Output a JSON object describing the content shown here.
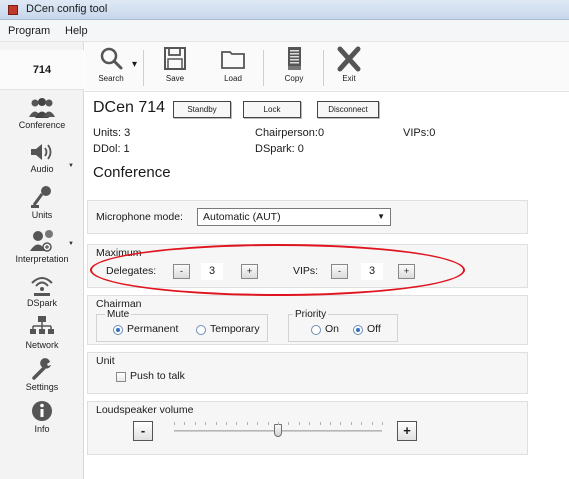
{
  "window": {
    "title": "DCen config tool"
  },
  "menu": [
    "Program",
    "Help"
  ],
  "sidebar": {
    "system_name": "714",
    "items": [
      {
        "label": "Conference",
        "icon": "people-icon"
      },
      {
        "label": "Audio",
        "icon": "speaker-icon"
      },
      {
        "label": "Units",
        "icon": "microphone-icon"
      },
      {
        "label": "Interpretation",
        "icon": "interpretation-icon"
      },
      {
        "label": "DSpark",
        "icon": "wireless-icon"
      },
      {
        "label": "Network",
        "icon": "network-icon"
      },
      {
        "label": "Settings",
        "icon": "wrench-icon"
      },
      {
        "label": "Info",
        "icon": "info-icon"
      }
    ]
  },
  "toolbar": {
    "search": "Search",
    "save": "Save",
    "load": "Load",
    "copy": "Copy",
    "exit": "Exit"
  },
  "header": {
    "device_name": "DCen 714",
    "standby_label": "Standby",
    "lock_label": "Lock",
    "disconnect_label": "Disconnect"
  },
  "stats": {
    "units": "Units: 3",
    "ddol": "DDol: 1",
    "chairperson": "Chairperson:0",
    "dspark": "DSpark: 0",
    "vips": "VIPs:0"
  },
  "section_title": "Conference",
  "microphone_mode": {
    "label": "Microphone mode:",
    "value": "Automatic (AUT)"
  },
  "maximum": {
    "title": "Maximum",
    "delegates_label": "Delegates:",
    "delegates_value": "3",
    "vips_label": "VIPs:",
    "vips_value": "3",
    "minus": "-",
    "plus": "+"
  },
  "chairman": {
    "title": "Chairman",
    "mute_title": "Mute",
    "permanent": "Permanent",
    "temporary": "Temporary",
    "mute_selected": "Permanent",
    "priority_title": "Priority",
    "on": "On",
    "off": "Off",
    "priority_selected": "Off"
  },
  "unit": {
    "title": "Unit",
    "push_to_talk": "Push to talk",
    "push_to_talk_checked": false
  },
  "loudspeaker": {
    "title": "Loudspeaker volume",
    "minus": "-",
    "plus": "+",
    "level_fraction": 0.5
  },
  "colors": {
    "annotation": "#e0141e",
    "radio_selected": "#2f6fc0"
  }
}
